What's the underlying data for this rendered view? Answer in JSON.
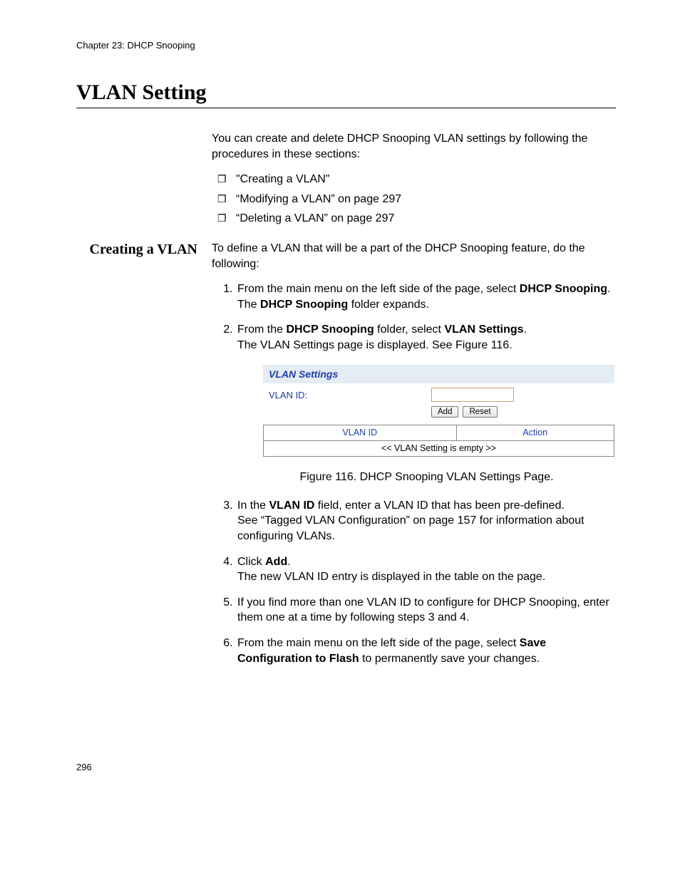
{
  "chapter_label": "Chapter 23: DHCP Snooping",
  "page_title": "VLAN Setting",
  "intro": "You can create and delete DHCP Snooping VLAN settings by following the procedures in these sections:",
  "bullets": [
    "\"Creating a VLAN\"",
    "“Modifying a VLAN” on page 297",
    "“Deleting a VLAN” on page 297"
  ],
  "subhead": "Creating a VLAN",
  "subhead_intro": "To define a VLAN that will be a part of the DHCP Snooping feature, do the following:",
  "step1_a": "From the main menu on the left side of the page, select ",
  "step1_b": "DHCP Snooping",
  "step1_c": ".",
  "step1_sub_a": "The ",
  "step1_sub_b": "DHCP Snooping",
  "step1_sub_c": " folder expands.",
  "step2_a": "From the ",
  "step2_b": "DHCP Snooping",
  "step2_c": " folder, select ",
  "step2_d": "VLAN Settings",
  "step2_e": ".",
  "step2_sub": "The VLAN Settings page is displayed. See Figure 116.",
  "figure": {
    "panel_title": "VLAN Settings",
    "field_label": "VLAN ID:",
    "btn_add": "Add",
    "btn_reset": "Reset",
    "col_vlanid": "VLAN ID",
    "col_action": "Action",
    "empty_msg": "<< VLAN Setting is empty >>",
    "caption": "Figure 116. DHCP Snooping VLAN Settings Page."
  },
  "step3_a": "In the ",
  "step3_b": "VLAN ID",
  "step3_c": " field, enter a VLAN ID that has been pre-defined.",
  "step3_sub": "See “Tagged VLAN Configuration” on page 157 for information about configuring VLANs.",
  "step4_a": "Click ",
  "step4_b": "Add",
  "step4_c": ".",
  "step4_sub": "The new VLAN ID entry is displayed in the table on the page.",
  "step5": "If you find more than one VLAN ID to configure for DHCP Snooping, enter them one at a time by following steps 3 and 4.",
  "step6_a": "From the main menu on the left side of the page, select ",
  "step6_b": "Save Configuration to Flash",
  "step6_c": " to permanently save your changes.",
  "page_number": "296"
}
